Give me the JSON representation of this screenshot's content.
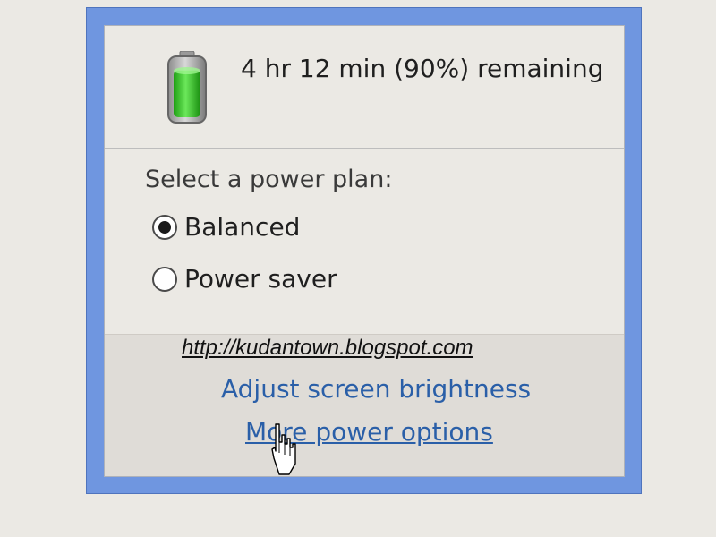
{
  "battery": {
    "status_text": "4 hr 12 min (90%) remaining",
    "charge_fraction": 0.9,
    "icon": "battery-icon"
  },
  "power_plan": {
    "heading": "Select a power plan:",
    "options": [
      {
        "label": "Balanced",
        "selected": true
      },
      {
        "label": "Power saver",
        "selected": false
      }
    ]
  },
  "links": {
    "watermark": "http://kudantown.blogspot.com",
    "adjust_brightness": "Adjust screen brightness",
    "more_options": "More power options"
  },
  "colors": {
    "frame_blue": "#6f96e0",
    "link_blue": "#2a5fa8",
    "battery_green": "#2fc21f"
  },
  "cursor": {
    "icon": "hand-pointer-icon"
  }
}
